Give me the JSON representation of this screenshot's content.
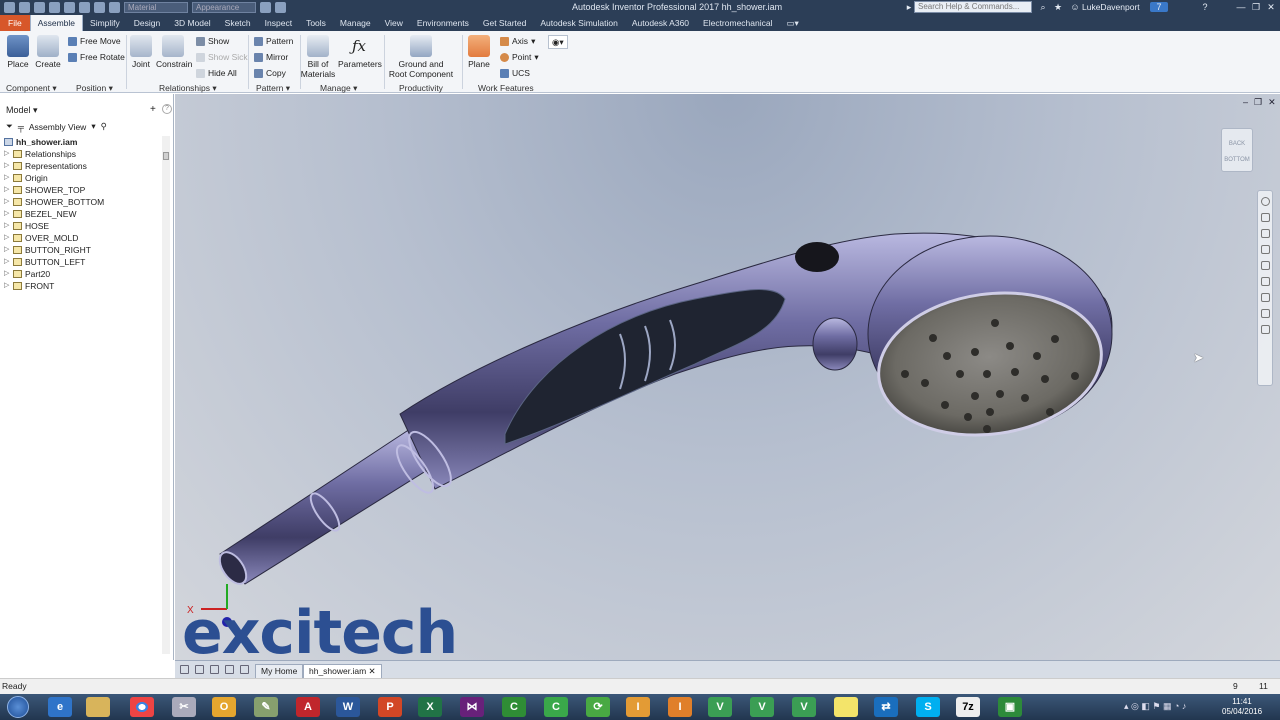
{
  "window": {
    "app_title": "Autodesk Inventor Professional 2017    hh_shower.iam",
    "search_placeholder": "Search Help & Commands...",
    "user": "LukeDavenport",
    "qa_dropdown1": "Material",
    "qa_dropdown2": "Appearance",
    "notify_count": "7"
  },
  "tabs": [
    "File",
    "Assemble",
    "Simplify",
    "Design",
    "3D Model",
    "Sketch",
    "Inspect",
    "Tools",
    "Manage",
    "View",
    "Environments",
    "Get Started",
    "Autodesk Simulation",
    "Autodesk A360",
    "Electromechanical"
  ],
  "ribbon": {
    "place": "Place",
    "create": "Create",
    "free_move": "Free Move",
    "free_rotate": "Free Rotate",
    "joint": "Joint",
    "constrain": "Constrain",
    "show": "Show",
    "show_sick": "Show Sick",
    "hide_all": "Hide All",
    "pattern": "Pattern",
    "mirror": "Mirror",
    "copy": "Copy",
    "bom_1": "Bill of",
    "bom_2": "Materials",
    "parameters": "Parameters",
    "ground_1": "Ground and",
    "ground_2": "Root Component",
    "plane": "Plane",
    "axis": "Axis",
    "point": "Point",
    "ucs": "UCS",
    "groups": {
      "component": "Component",
      "position": "Position",
      "relationships": "Relationships",
      "pattern": "Pattern",
      "manage": "Manage",
      "productivity": "Productivity",
      "work_features": "Work Features"
    }
  },
  "browser": {
    "header": "Model",
    "view": "Assembly View",
    "root": "hh_shower.iam",
    "items": [
      "Relationships",
      "Representations",
      "Origin",
      "SHOWER_TOP",
      "SHOWER_BOTTOM",
      "BEZEL_NEW",
      "HOSE",
      "OVER_MOLD",
      "BUTTON_RIGHT",
      "BUTTON_LEFT",
      "Part20",
      "FRONT"
    ]
  },
  "viewport": {
    "viewcube_top": "BACK",
    "viewcube_bottom": "BOTTOM",
    "axis_x": "X",
    "watermark": "excitech"
  },
  "doc_tabs": {
    "home": "My Home",
    "file": "hh_shower.iam"
  },
  "status": {
    "text": "Ready",
    "count1": "9",
    "count2": "11"
  },
  "clock": {
    "time": "11:41",
    "date": "05/04/2016"
  },
  "colors": {
    "titlebar": "#2c3e57",
    "file_tab": "#d7572a",
    "body_purple": "#6b6a9e",
    "watermark": "#2c4f92"
  }
}
